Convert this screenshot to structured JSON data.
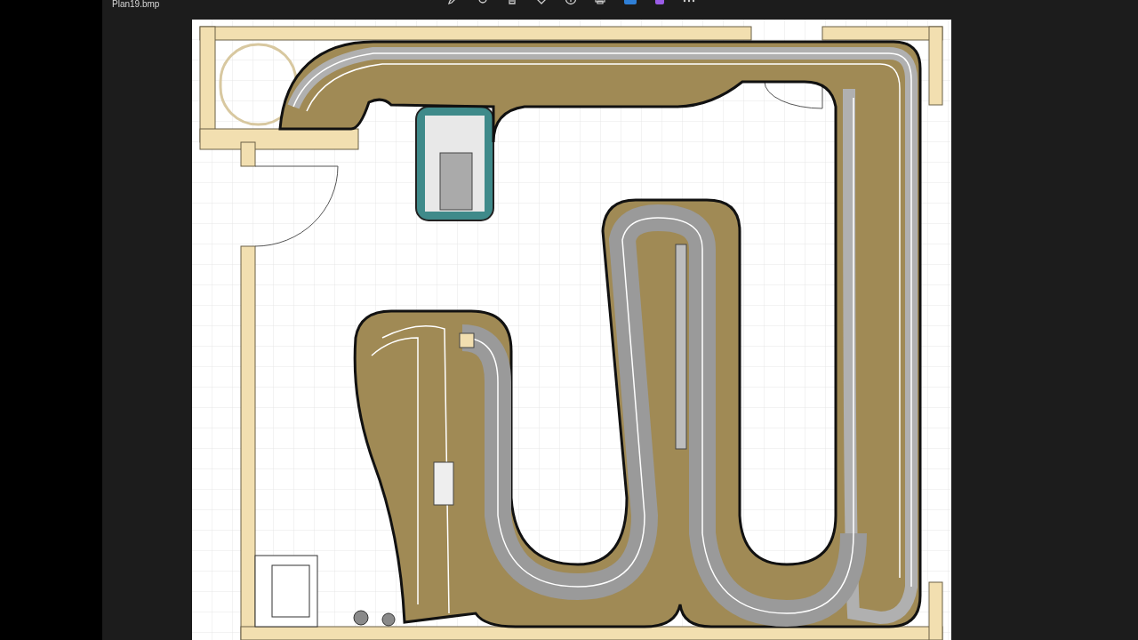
{
  "window": {
    "title": "Plan19.bmp"
  }
}
